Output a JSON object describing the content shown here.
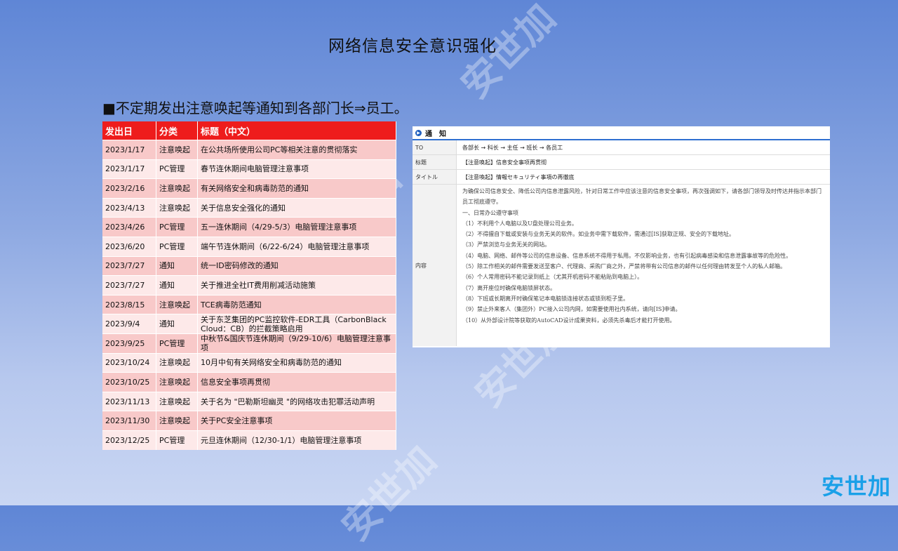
{
  "title": "网络信息安全意识强化",
  "subtitle": "■不定期发出注意唤起等通知到各部门长⇒员工。",
  "table": {
    "headers": [
      "发出日",
      "分类",
      "标题（中文）"
    ],
    "rows": [
      [
        "2023/1/17",
        "注意唤起",
        "在公共场所使用公司PC等相关注意的贯彻落实"
      ],
      [
        "2023/1/17",
        "PC管理",
        "春节连休期间电脑管理注意事项"
      ],
      [
        "2023/2/16",
        "注意唤起",
        "有关网络安全和病毒防范的通知"
      ],
      [
        "2023/4/13",
        "注意唤起",
        "关于信息安全强化的通知"
      ],
      [
        "2023/4/26",
        "PC管理",
        "五一连休期间（4/29-5/3）电脑管理注意事项"
      ],
      [
        "2023/6/20",
        "PC管理",
        "端午节连休期间（6/22-6/24）电脑管理注意事项"
      ],
      [
        "2023/7/27",
        "通知",
        "统一ID密码修改的通知"
      ],
      [
        "2023/7/27",
        "通知",
        "关于推进全社IT费用削减活动施策"
      ],
      [
        "2023/8/15",
        "注意唤起",
        "TCE病毒防范通知"
      ],
      [
        "2023/9/4",
        "通知",
        "关于东芝集团的PC监控软件-EDR工具（CarbonBlack Cloud：CB）的拦截策略启用"
      ],
      [
        "2023/9/25",
        "PC管理",
        "中秋节&国庆节连休期间（9/29-10/6）电脑管理注意事项"
      ],
      [
        "2023/10/24",
        "注意唤起",
        "10月中旬有关网络安全和病毒防范的通知"
      ],
      [
        "2023/10/25",
        "注意唤起",
        "信息安全事项再贯彻"
      ],
      [
        "2023/11/13",
        "注意唤起",
        "关于名为 \"巴勒斯坦幽灵 \"的网络攻击犯罪活动声明"
      ],
      [
        "2023/11/30",
        "注意唤起",
        "关于PC安全注意事项"
      ],
      [
        "2023/12/25",
        "PC管理",
        "元旦连休期间（12/30-1/1）电脑管理注意事项"
      ]
    ]
  },
  "notice": {
    "header": "通　知",
    "to_label": "TO",
    "to_value": "各部长 → 科长 → 主任 → 班长 → 各员工",
    "subject_label": "标题",
    "subject_value": "【注意唤起】信息安全事项再贯彻",
    "title_label": "タイトル",
    "title_value": "【注意喚起】情報セキュリティ事項の再徹底",
    "content_label": "内容",
    "content": [
      "为确保公司信息安全、降低公司内信息泄露风险，针对日常工作中应该注意的信息安全事项，再次强调如下，请各部门领导及时传达并指示本部门员工彻底遵守。",
      "",
      "一、日常办公遵守事项",
      "（1）不利用个人电脑以及U盘处理公司业务。",
      "（2）不得擅自下载或安装与业务无关的软件。如业务中需下载软件，需通过[IS]获取正规、安全的下载地址。",
      "（3）严禁浏览与业务无关的网站。",
      "（4）电脑、网络、邮件等公司的信息设备、信息系统不得用于私用。不仅影响业务，也有引起病毒感染和信息泄露事故等的危险性。",
      "（5）除工作相关的邮件需要发送至客户、代理商、采购厂商之外，严禁将带有公司信息的邮件以任何理由转发至个人的私人邮箱。",
      "（6）个人常用密码不能记录到纸上（尤其开机密码不能粘贴到电脑上）。",
      "（7）离开座位时确保电脑锁屏状态。",
      "（8）下班或长期离开时确保笔记本电脑锁连接状态或锁到柜子里。",
      "（9）禁止外来客人（集团外）PC接入公司内网，如需要使用社内系统，请向[IS]申请。",
      "（10）从外部设计院等获取的AutoCAD设计成果资料，必须先杀毒后才能打开使用。"
    ]
  },
  "watermark": "安世加",
  "logo": "安世加"
}
